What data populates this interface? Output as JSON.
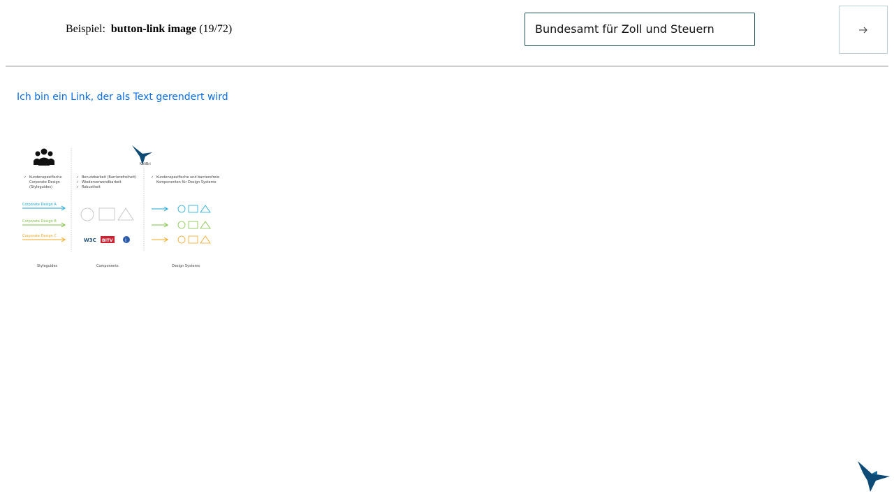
{
  "header": {
    "example_prefix": "Beispiel:",
    "component_name": "button-link image",
    "counter": "(19/72)"
  },
  "selector": {
    "value": "Bundesamt für Zoll und Steuern"
  },
  "next_button": {
    "icon": "arrow-right-icon"
  },
  "link": {
    "text": "Ich bin ein Link, der als Text gerendert wird"
  },
  "illustration": {
    "logo_text": "KoliBri",
    "col1_checks": [
      "Kundenspezifische",
      "Corporate Design",
      "(Styleguides)"
    ],
    "col2_checks": [
      "Benutzbarkeit (Barrierefreiheit)",
      "Wiederverwendbarkeit",
      "Robustheit"
    ],
    "col3_checks": [
      "Kundenspezifische und barrierefreie",
      "Komponenten für Design Systeme"
    ],
    "designs": [
      "Corporate Design A",
      "Corporate Design B",
      "Corporate Design C"
    ],
    "captions": [
      "Styleguides",
      "Components",
      "Design Systems"
    ],
    "badge_w3c": "W3C",
    "badge_bitv": "BITV",
    "colors": {
      "a": "#1aa6d6",
      "b": "#7dc242",
      "c": "#f2a51f",
      "brand": "#0d4a75"
    }
  },
  "corner_logo": {
    "icon": "kolibri-logo-icon"
  }
}
